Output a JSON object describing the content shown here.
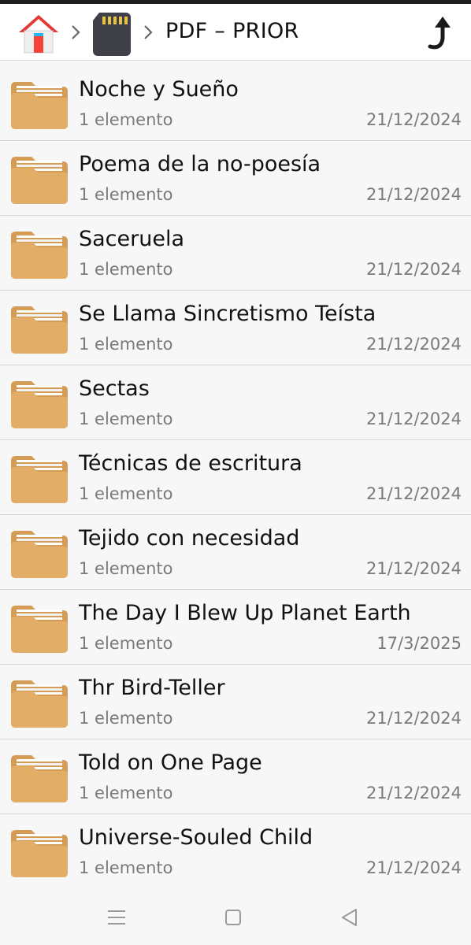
{
  "header": {
    "current_folder": "PDF – PRIOR",
    "icons": {
      "home": "home-icon",
      "separator": "chevron-right-icon",
      "storage": "sd-card-icon",
      "up": "arrow-up-icon"
    }
  },
  "list": {
    "items": [
      {
        "name": "Noche y Sueño",
        "count": "1 elemento",
        "date": "21/12/2024"
      },
      {
        "name": "Poema de la no-poesía",
        "count": "1 elemento",
        "date": "21/12/2024"
      },
      {
        "name": "Saceruela",
        "count": "1 elemento",
        "date": "21/12/2024"
      },
      {
        "name": "Se Llama Sincretismo Teísta",
        "count": "1 elemento",
        "date": "21/12/2024"
      },
      {
        "name": "Sectas",
        "count": "1 elemento",
        "date": "21/12/2024"
      },
      {
        "name": "Técnicas de escritura",
        "count": "1 elemento",
        "date": "21/12/2024"
      },
      {
        "name": "Tejido con necesidad",
        "count": "1 elemento",
        "date": "21/12/2024"
      },
      {
        "name": "The Day I Blew Up Planet Earth",
        "count": "1 elemento",
        "date": "17/3/2025"
      },
      {
        "name": "Thr Bird-Teller",
        "count": "1 elemento",
        "date": "21/12/2024"
      },
      {
        "name": "Told on One Page",
        "count": "1 elemento",
        "date": "21/12/2024"
      },
      {
        "name": "Universe-Souled Child",
        "count": "1 elemento",
        "date": "21/12/2024"
      }
    ],
    "icon": "folder-icon"
  },
  "navbar": {
    "icons": [
      "menu-icon",
      "home-square-icon",
      "back-triangle-icon"
    ]
  },
  "colors": {
    "folder": "#e2ae67",
    "folder_dark": "#d49c55",
    "text_secondary": "#7a7a7a",
    "background": "#f7f7f7",
    "divider": "#d6d6d6"
  }
}
